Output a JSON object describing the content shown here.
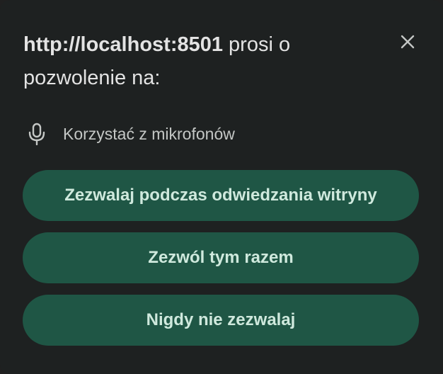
{
  "dialog": {
    "title_host": "http://localhost:8501",
    "title_rest": " prosi o pozwolenie na:",
    "close_icon": "close-icon"
  },
  "permission": {
    "icon": "microphone-icon",
    "label": "Korzystać z mikrofonów"
  },
  "buttons": {
    "allow_on_visit": "Zezwalaj podczas odwiedzania witryny",
    "allow_this_time": "Zezwól tym razem",
    "never_allow": "Nigdy nie zezwalaj"
  },
  "colors": {
    "background": "#1e2121",
    "button_bg": "#1f5645",
    "button_text": "#cfe9dd",
    "text": "#e3e3e3",
    "secondary_text": "#c4c7c5"
  }
}
